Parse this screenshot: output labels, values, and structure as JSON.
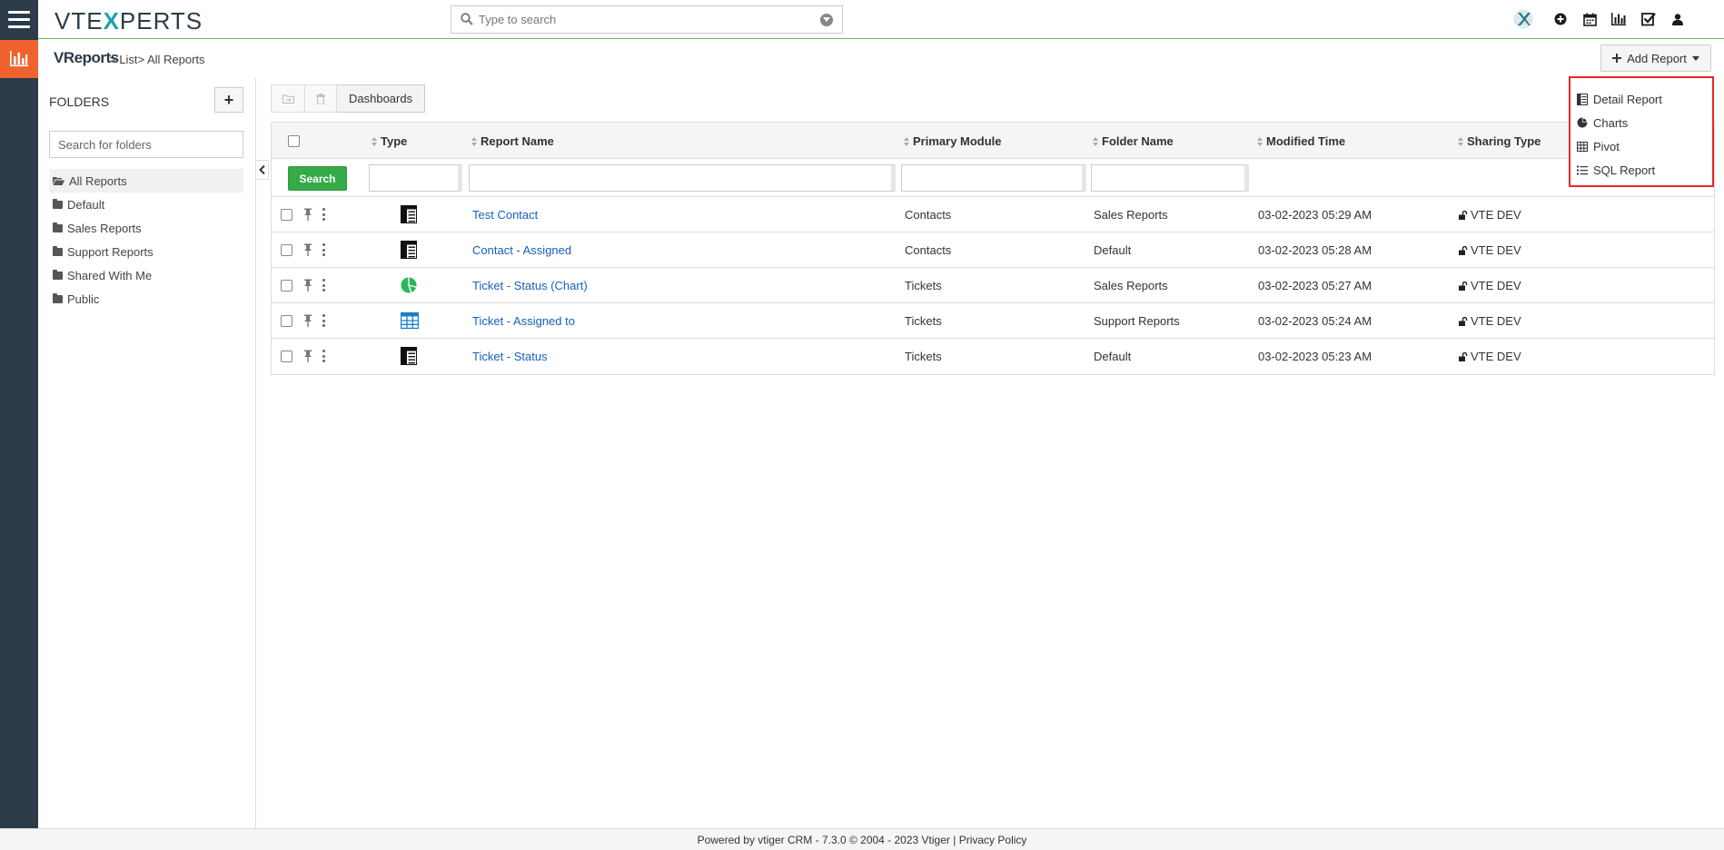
{
  "app": {
    "logo_prefix": "VTE",
    "logo_x": "X",
    "logo_suffix": "PERTS"
  },
  "search": {
    "placeholder": "Type to search"
  },
  "top_icons": [
    "vtexperts-x-icon",
    "plus-circle-icon",
    "calendar-icon",
    "reports-icon",
    "task-check-icon",
    "user-icon"
  ],
  "breadcrumb": {
    "module": "VReports",
    "sep1": ">",
    "list": "List",
    "sep2": ">",
    "current": "All Reports"
  },
  "add_report": {
    "label": "Add Report",
    "menu": [
      {
        "label": "Detail Report",
        "icon": "detail-report-icon"
      },
      {
        "label": "Charts",
        "icon": "pie-chart-icon"
      },
      {
        "label": "Pivot",
        "icon": "pivot-table-icon"
      },
      {
        "label": "SQL Report",
        "icon": "list-icon"
      }
    ]
  },
  "sidebar": {
    "title": "FOLDERS",
    "add_label": "+",
    "search_placeholder": "Search for folders",
    "folders": [
      "All Reports",
      "Default",
      "Sales Reports",
      "Support Reports",
      "Shared With Me",
      "Public"
    ]
  },
  "toolbar": {
    "dashboards": "Dashboards"
  },
  "table": {
    "headers": {
      "type": "Type",
      "name": "Report Name",
      "module": "Primary Module",
      "folder": "Folder Name",
      "modified": "Modified Time",
      "sharing": "Sharing Type"
    },
    "search_label": "Search",
    "rows": [
      {
        "type": "detail",
        "name": "Test Contact",
        "module": "Contacts",
        "folder": "Sales Reports",
        "modified": "03-02-2023 05:29 AM",
        "sharing": "VTE DEV"
      },
      {
        "type": "detail",
        "name": "Contact - Assigned",
        "module": "Contacts",
        "folder": "Default",
        "modified": "03-02-2023 05:28 AM",
        "sharing": "VTE DEV"
      },
      {
        "type": "chart",
        "name": "Ticket - Status (Chart)",
        "module": "Tickets",
        "folder": "Sales Reports",
        "modified": "03-02-2023 05:27 AM",
        "sharing": "VTE DEV"
      },
      {
        "type": "pivot",
        "name": "Ticket - Assigned to",
        "module": "Tickets",
        "folder": "Support Reports",
        "modified": "03-02-2023 05:24 AM",
        "sharing": "VTE DEV"
      },
      {
        "type": "detail",
        "name": "Ticket - Status",
        "module": "Tickets",
        "folder": "Default",
        "modified": "03-02-2023 05:23 AM",
        "sharing": "VTE DEV"
      }
    ]
  },
  "footer": {
    "powered": "Powered by vtiger CRM - 7.3.0  © 2004 - 2023 ",
    "vtiger": "Vtiger",
    "sep": "|",
    "privacy": "Privacy Policy"
  },
  "colors": {
    "sidebar_dark": "#2c3b48",
    "module_accent": "#f0622d",
    "search_green": "#35aa47",
    "link_blue": "#1560bd",
    "highlight_red": "#e8262c"
  }
}
